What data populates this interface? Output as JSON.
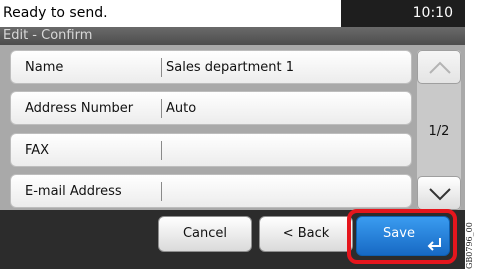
{
  "status": {
    "message": "Ready to send.",
    "time": "10:10"
  },
  "title": "Edit - Confirm",
  "fields": [
    {
      "label": "Name",
      "value": "Sales department 1"
    },
    {
      "label": "Address Number",
      "value": "Auto"
    },
    {
      "label": "FAX",
      "value": ""
    },
    {
      "label": "E-mail Address",
      "value": ""
    }
  ],
  "pagination": {
    "page": "1/2",
    "up_icon": "chevron-up-icon",
    "down_icon": "chevron-down-icon"
  },
  "buttons": {
    "cancel": "Cancel",
    "back": "< Back",
    "save": "Save",
    "save_icon": "enter-icon"
  },
  "side_code": "GB0796_00",
  "colors": {
    "save_blue": "#1f7ad6",
    "highlight_red": "#e5161d"
  }
}
